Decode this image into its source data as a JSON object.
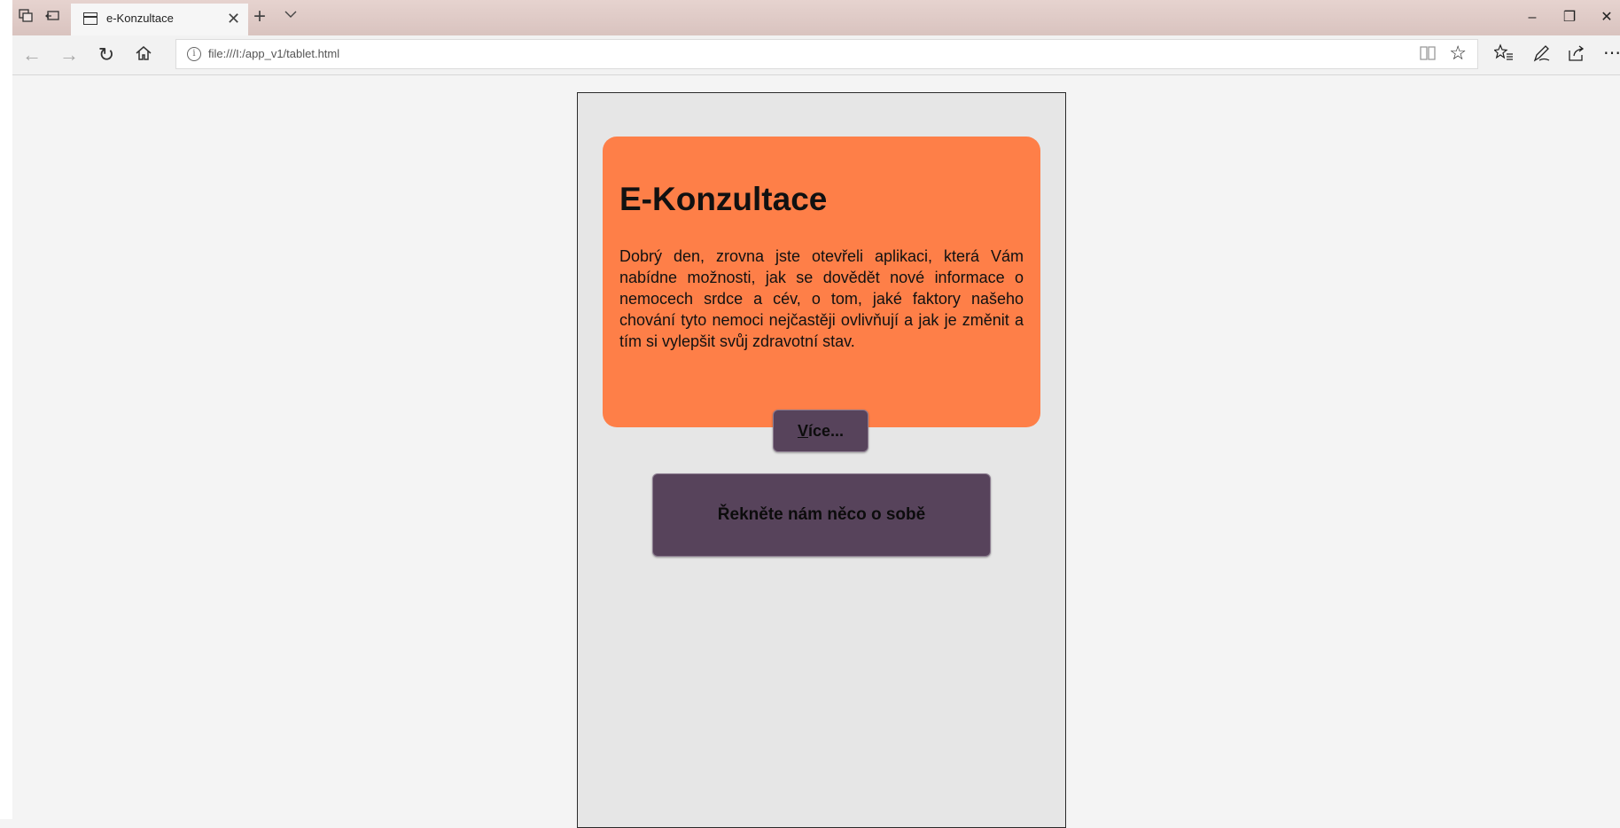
{
  "browser": {
    "tab": {
      "title": "e-Konzultace",
      "close_glyph": "✕"
    },
    "new_tab_glyph": "+",
    "window_controls": {
      "minimize": "–",
      "restore": "❐",
      "close": "✕"
    },
    "address": {
      "url": "file:///I:/app_v1/tablet.html",
      "info_glyph": "i",
      "favorite_glyph": "☆"
    },
    "nav": {
      "back_glyph": "←",
      "forward_glyph": "→",
      "refresh_glyph": "↻",
      "more_glyph": "⋯"
    }
  },
  "app": {
    "card": {
      "title": "E-Konzultace",
      "text": "Dobrý den, zrovna jste otevřeli aplikaci, která Vám nabídne možnosti, jak se dovědět nové informace o nemocech srdce a cév, o tom, jaké faktory našeho chování tyto nemoci nejčastěji ovlivňují a jak je změnit a tím si vylepšit svůj zdravotní stav."
    },
    "more_button": {
      "accel": "V",
      "rest": "íce..."
    },
    "about_button": {
      "label": "Řekněte nám něco o sobě"
    },
    "colors": {
      "card": "#fe7f48",
      "button": "#57435b",
      "device_bg": "#e6e6e6",
      "page_bg": "#f4f4f4"
    }
  }
}
